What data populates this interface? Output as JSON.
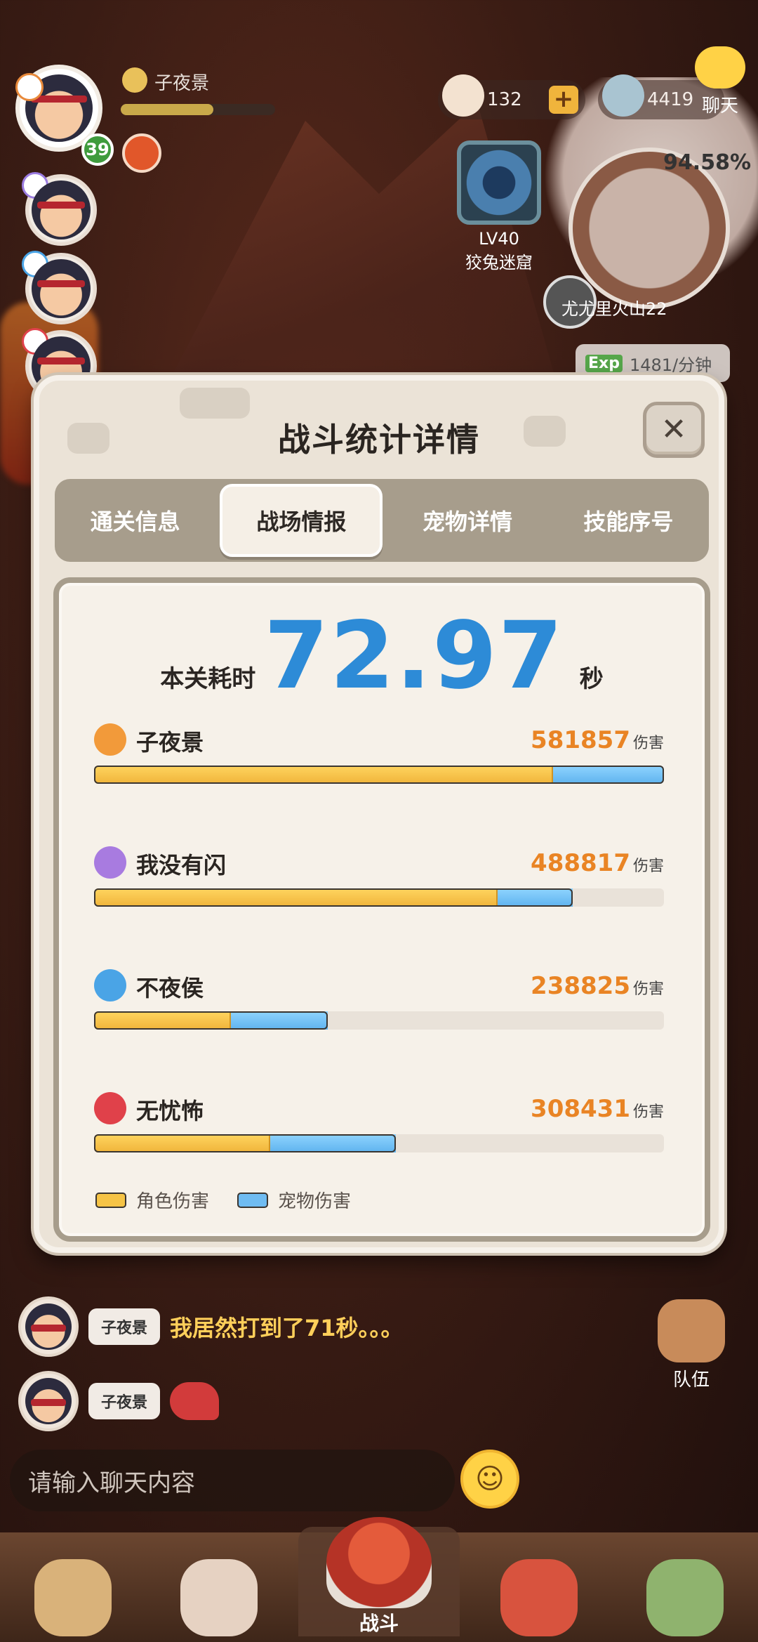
{
  "hud": {
    "player_name": "子夜景",
    "player_level": "39",
    "resource_shells": "132",
    "resource_stones": "4419",
    "chat_label": "聊天",
    "dungeon_level": "LV40",
    "dungeon_name": "狡兔迷窟",
    "map_progress": "94.58%",
    "map_name": "尤尤里火山22",
    "exp_icon": "Exp",
    "exp_rate": "1481/分钟"
  },
  "modal": {
    "title": "战斗统计详情",
    "close_icon": "close-icon",
    "tabs": [
      {
        "label": "通关信息",
        "active": false
      },
      {
        "label": "战场情报",
        "active": true
      },
      {
        "label": "宠物详情",
        "active": false
      },
      {
        "label": "技能序号",
        "active": false
      }
    ],
    "time_label": "本关耗时",
    "time_value": "72.97",
    "time_unit": "秒",
    "damage_unit": "伤害",
    "players": [
      {
        "name": "子夜景",
        "damage": "581857",
        "char_ratio": 0.805,
        "pet_ratio": 0.195,
        "icon": "fire-element-icon",
        "icon_color": "#f29a3a"
      },
      {
        "name": "我没有闪",
        "damage": "488817",
        "char_ratio": 0.708,
        "pet_ratio": 0.132,
        "icon": "wind-element-icon",
        "icon_color": "#a87be0"
      },
      {
        "name": "不夜侯",
        "damage": "238825",
        "char_ratio": 0.24,
        "pet_ratio": 0.17,
        "icon": "water-element-icon",
        "icon_color": "#4aa4e6"
      },
      {
        "name": "无忧怖",
        "damage": "308431",
        "char_ratio": 0.309,
        "pet_ratio": 0.221,
        "icon": "blood-element-icon",
        "icon_color": "#e0414a"
      }
    ],
    "legend": {
      "char": "角色伤害",
      "pet": "宠物伤害"
    },
    "colors": {
      "char_bar": "#f6c446",
      "pet_bar": "#6fbcf2",
      "damage_number": "#e98424",
      "time_number": "#2d8bd7"
    }
  },
  "chat": {
    "messages": [
      {
        "sender": "子夜景",
        "text": "我居然打到了71秒。。。"
      },
      {
        "sender": "子夜景",
        "sticker": "dragon-sticker"
      }
    ],
    "input_placeholder": "请输入聊天内容",
    "team_label": "队伍"
  },
  "nav": {
    "battle_label": "战斗"
  }
}
